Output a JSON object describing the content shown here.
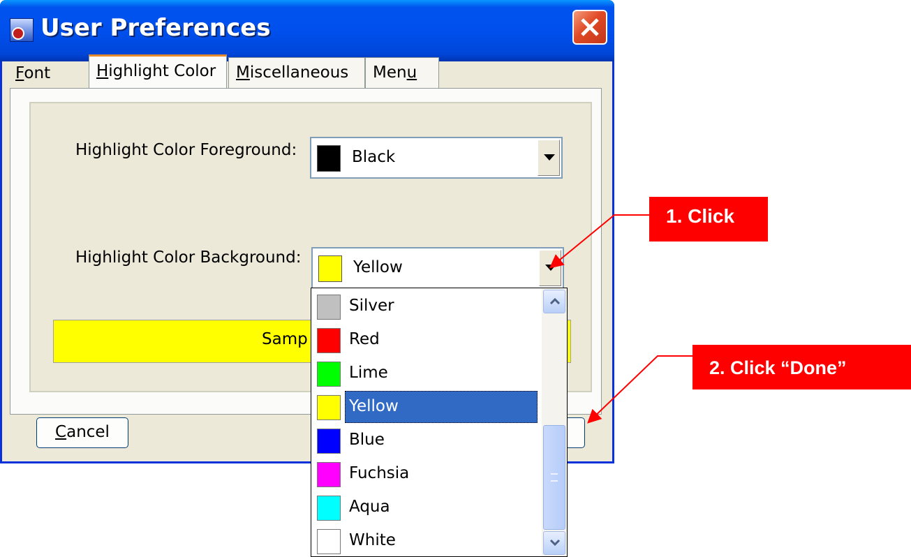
{
  "window": {
    "title": "User Preferences"
  },
  "tabs": [
    {
      "prefix": "",
      "underline": "F",
      "suffix": "ont"
    },
    {
      "prefix": "",
      "underline": "H",
      "suffix": "ighlight Color"
    },
    {
      "prefix": "",
      "underline": "M",
      "suffix": "iscellaneous"
    },
    {
      "prefix": "Men",
      "underline": "u",
      "suffix": ""
    }
  ],
  "foreground": {
    "label": "Highlight Color Foreground:",
    "value": "Black",
    "color": "#000000"
  },
  "background": {
    "label": "Highlight Color Background:",
    "value": "Yellow",
    "color": "#ffff00"
  },
  "sample": {
    "text": "Samp"
  },
  "buttons": {
    "cancel_underline": "C",
    "cancel_rest": "ancel"
  },
  "dropdown": {
    "items": [
      {
        "label": "Silver",
        "color": "#c0c0c0"
      },
      {
        "label": "Red",
        "color": "#ff0000"
      },
      {
        "label": "Lime",
        "color": "#00ff00"
      },
      {
        "label": "Yellow",
        "color": "#ffff00",
        "selected": true
      },
      {
        "label": "Blue",
        "color": "#0000ff"
      },
      {
        "label": "Fuchsia",
        "color": "#ff00ff"
      },
      {
        "label": "Aqua",
        "color": "#00ffff"
      },
      {
        "label": "White",
        "color": "#ffffff"
      }
    ]
  },
  "callouts": {
    "step1": "1. Click",
    "step2": "2. Click “Done”",
    "color": "#ff0000"
  }
}
